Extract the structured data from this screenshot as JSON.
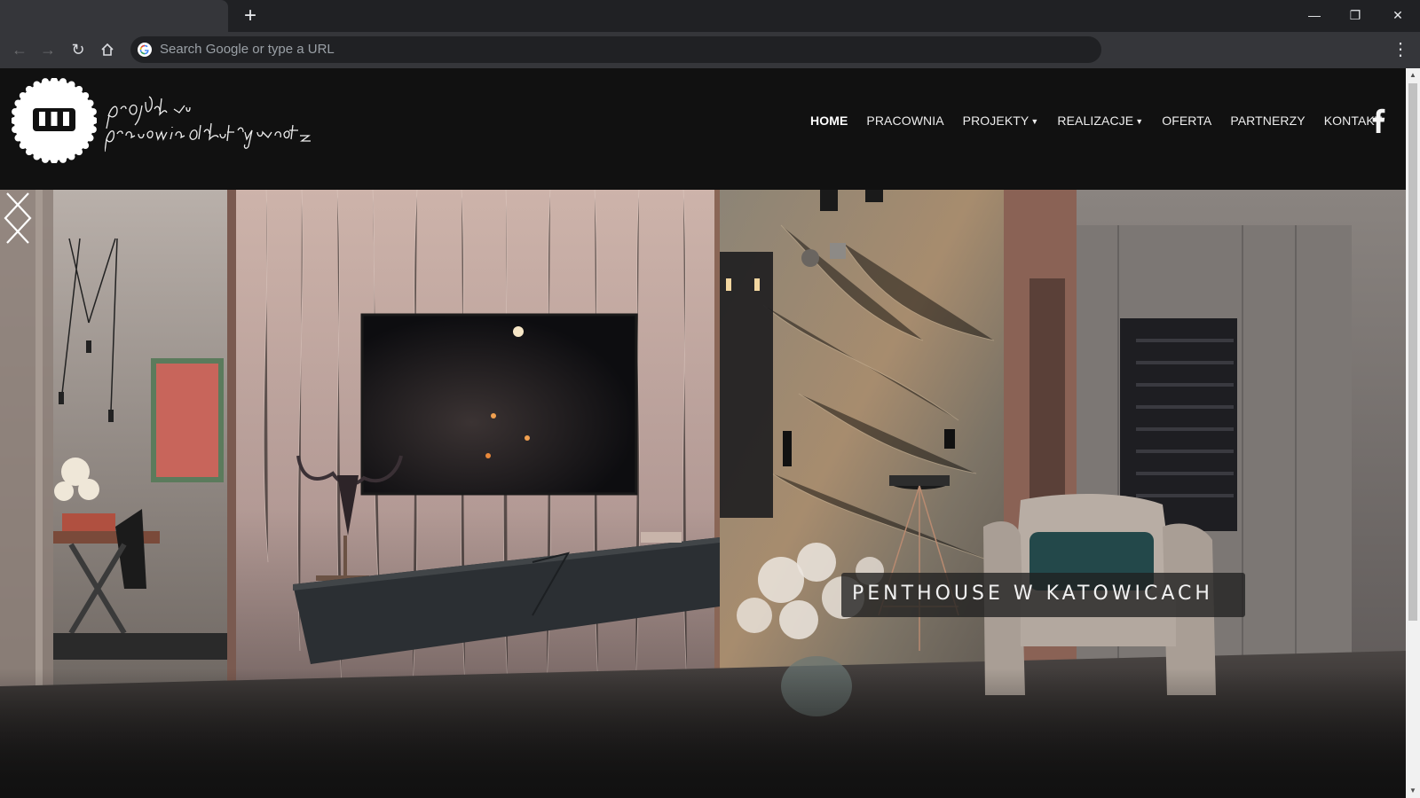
{
  "browser": {
    "new_tab_label": "+",
    "omnibox_placeholder": "Search Google or type a URL",
    "window_controls": [
      "minimize",
      "restore",
      "close"
    ]
  },
  "site": {
    "logo_letter": "w",
    "logo_script_line1": "projekt w",
    "logo_script_line2": "pracownia architektury wnętrz",
    "nav": [
      {
        "label": "HOME",
        "active": true,
        "dropdown": false
      },
      {
        "label": "PRACOWNIA",
        "active": false,
        "dropdown": false
      },
      {
        "label": "PROJEKTY",
        "active": false,
        "dropdown": true
      },
      {
        "label": "REALIZACJE",
        "active": false,
        "dropdown": true
      },
      {
        "label": "OFERTA",
        "active": false,
        "dropdown": false
      },
      {
        "label": "PARTNERZY",
        "active": false,
        "dropdown": false
      },
      {
        "label": "KONTAKT",
        "active": false,
        "dropdown": false
      }
    ],
    "social_icon": "facebook-icon"
  },
  "slider": {
    "caption": "PENTHOUSE W KATOWICACH",
    "prev_icon": "chevron-left-icon",
    "next_icon": "chevron-right-icon"
  },
  "colors": {
    "chrome_dark": "#202124",
    "chrome_toolbar": "#35363a",
    "page_bg": "#111111",
    "nav_text": "#ededed"
  }
}
